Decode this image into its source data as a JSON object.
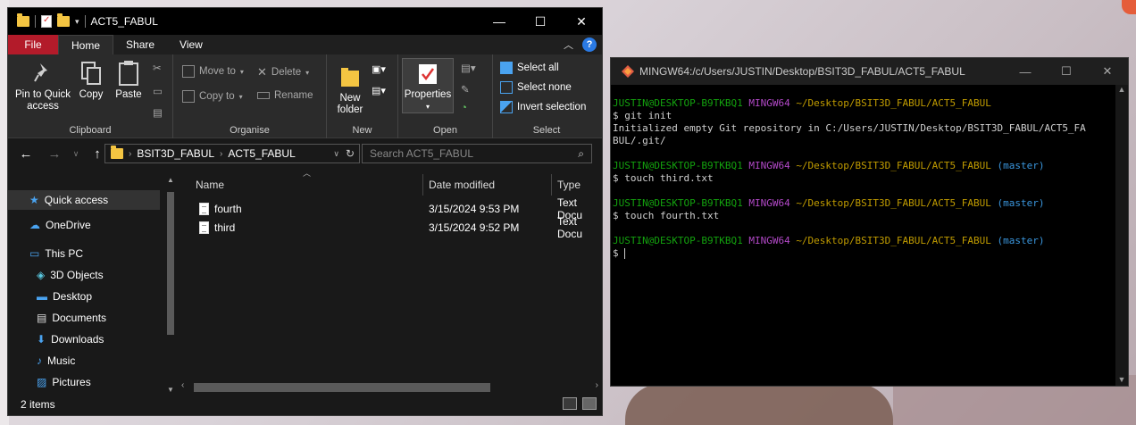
{
  "explorer": {
    "title": "ACT5_FABUL",
    "window_controls": {
      "minimize": "—",
      "maximize": "☐",
      "close": "✕"
    },
    "tabs": [
      {
        "label": "File"
      },
      {
        "label": "Home"
      },
      {
        "label": "Share"
      },
      {
        "label": "View"
      }
    ],
    "help": "?",
    "ribbon": {
      "clipboard": {
        "label": "Clipboard",
        "pin": "Pin to Quick access",
        "copy": "Copy",
        "paste": "Paste"
      },
      "organise": {
        "label": "Organise",
        "move_to": "Move to",
        "copy_to": "Copy to",
        "delete": "Delete",
        "rename": "Rename"
      },
      "new": {
        "label": "New",
        "new_folder": "New folder"
      },
      "open": {
        "label": "Open",
        "properties": "Properties"
      },
      "select": {
        "label": "Select",
        "select_all": "Select all",
        "select_none": "Select none",
        "invert_selection": "Invert selection"
      }
    },
    "address": {
      "path": [
        "BSIT3D_FABUL",
        "ACT5_FABUL"
      ],
      "search_placeholder": "Search ACT5_FABUL"
    },
    "nav_pane": {
      "items": [
        {
          "label": "Quick access",
          "icon": "star-icon"
        },
        {
          "label": "OneDrive",
          "icon": "cloud-icon"
        },
        {
          "label": "This PC",
          "icon": "computer-icon"
        },
        {
          "label": "3D Objects",
          "icon": "cube-icon"
        },
        {
          "label": "Desktop",
          "icon": "desktop-icon"
        },
        {
          "label": "Documents",
          "icon": "documents-icon"
        },
        {
          "label": "Downloads",
          "icon": "download-icon"
        },
        {
          "label": "Music",
          "icon": "music-icon"
        },
        {
          "label": "Pictures",
          "icon": "pictures-icon"
        }
      ]
    },
    "columns": {
      "name": "Name",
      "date_modified": "Date modified",
      "type": "Type"
    },
    "files": [
      {
        "name": "fourth",
        "date": "3/15/2024 9:53 PM",
        "type": "Text Docu"
      },
      {
        "name": "third",
        "date": "3/15/2024 9:52 PM",
        "type": "Text Docu"
      }
    ],
    "status": "2 items"
  },
  "terminal": {
    "title": "MINGW64:/c/Users/JUSTIN/Desktop/BSIT3D_FABUL/ACT5_FABUL",
    "window_controls": {
      "minimize": "—",
      "maximize": "☐",
      "close": "✕"
    },
    "user_host": "JUSTIN@DESKTOP-B9TKBQ1",
    "shell": "MINGW64",
    "cwd": "~/Desktop/BSIT3D_FABUL/ACT5_FABUL",
    "branch": "(master)",
    "cmd1": "$ git init",
    "out1": "Initialized empty Git repository in C:/Users/JUSTIN/Desktop/BSIT3D_FABUL/ACT5_FA",
    "out1b": "BUL/.git/",
    "cmd2": "$ touch third.txt",
    "cmd3": "$ touch fourth.txt",
    "prompt": "$ "
  },
  "colors": {
    "file_tab": "#b31b2a",
    "git_user": "#13a10e",
    "git_shell": "#b148c6",
    "git_path": "#c19c00",
    "git_branch": "#3a96dd"
  }
}
